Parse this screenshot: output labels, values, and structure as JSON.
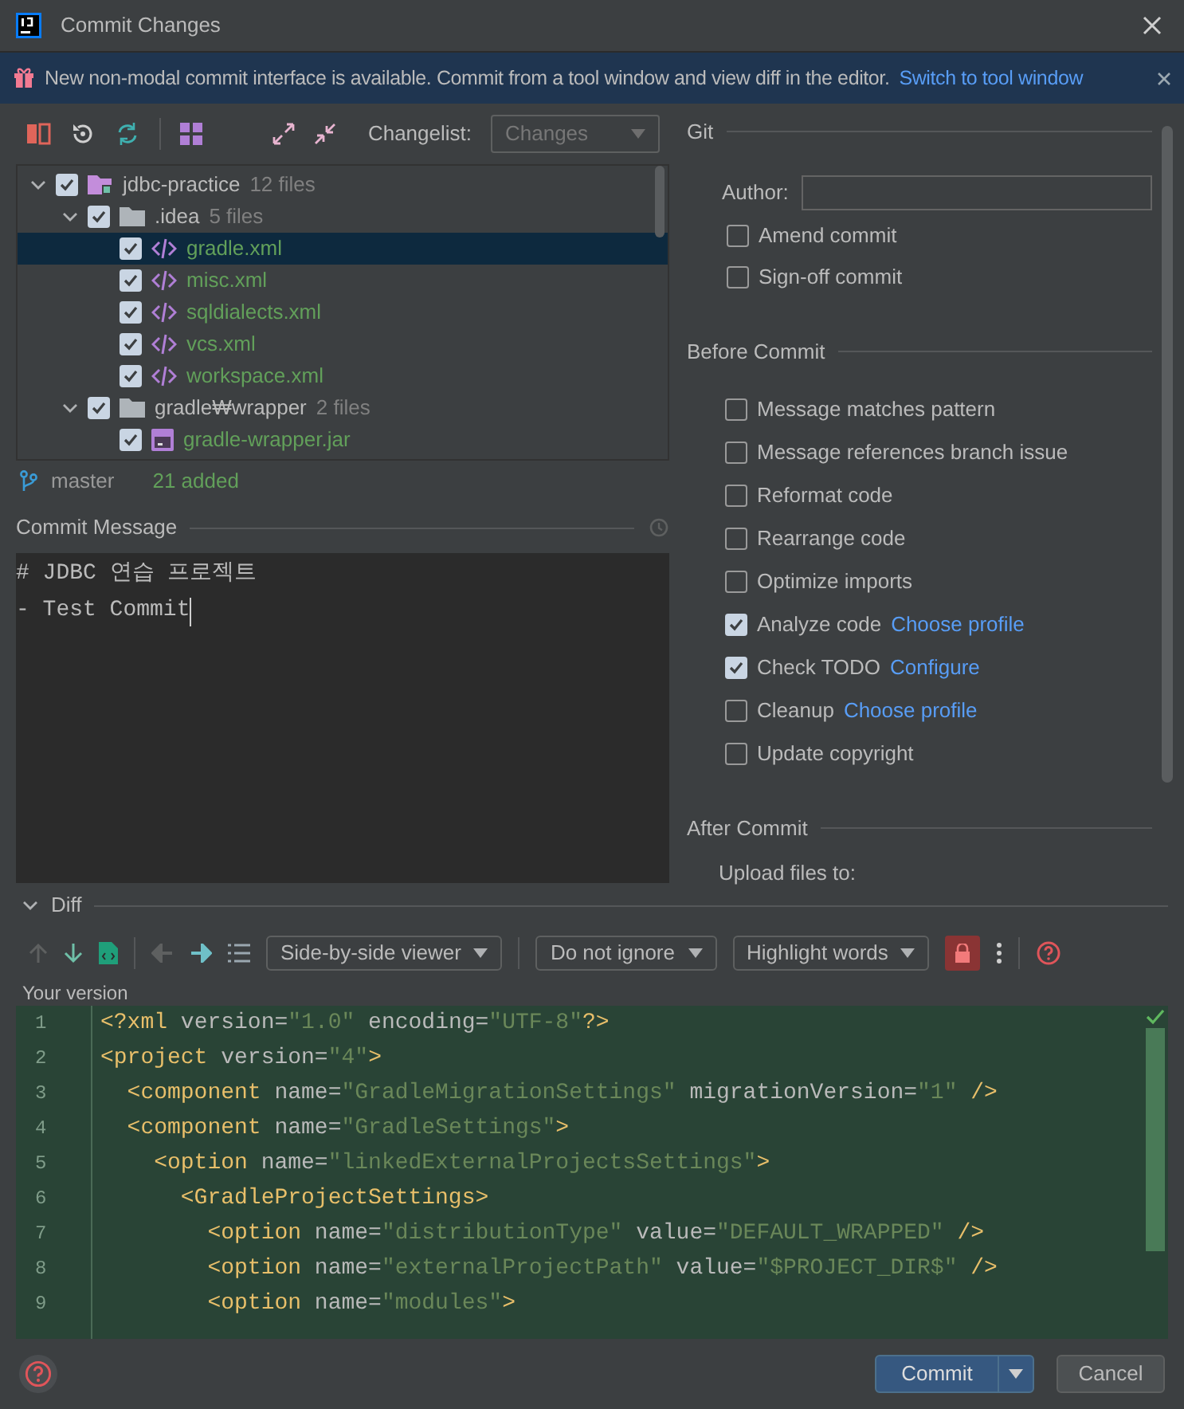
{
  "window": {
    "title": "Commit Changes"
  },
  "banner": {
    "text": "New non-modal commit interface is available. Commit from a tool window and view diff in the editor.",
    "link": "Switch to tool window"
  },
  "changes_toolbar": {
    "changelist_label": "Changelist:",
    "changelist_value": "Changes"
  },
  "tree": [
    {
      "kind": "module",
      "name": "jdbc-practice",
      "count": "12 files",
      "checked": true,
      "expanded": true,
      "selected": false,
      "children": [
        {
          "kind": "folder",
          "name": ".idea",
          "count": "5 files",
          "checked": true,
          "expanded": true,
          "selected": false,
          "children": [
            {
              "kind": "xml",
              "name": "gradle.xml",
              "checked": true,
              "selected": true
            },
            {
              "kind": "xml",
              "name": "misc.xml",
              "checked": true,
              "selected": false
            },
            {
              "kind": "xml",
              "name": "sqldialects.xml",
              "checked": true,
              "selected": false
            },
            {
              "kind": "xml",
              "name": "vcs.xml",
              "checked": true,
              "selected": false
            },
            {
              "kind": "xml",
              "name": "workspace.xml",
              "checked": true,
              "selected": false
            }
          ]
        },
        {
          "kind": "folder",
          "name": "gradle₩wrapper",
          "count": "2 files",
          "checked": true,
          "expanded": true,
          "selected": false,
          "children": [
            {
              "kind": "jar",
              "name": "gradle-wrapper.jar",
              "checked": true,
              "selected": false
            }
          ]
        }
      ]
    }
  ],
  "status": {
    "branch": "master",
    "summary": "21 added"
  },
  "commit_message": {
    "title": "Commit Message",
    "lines": [
      "# JDBC 연습 프로젝트",
      "- Test Commit"
    ]
  },
  "git": {
    "title": "Git",
    "author_label": "Author:",
    "options": [
      {
        "label": "Amend commit",
        "checked": false
      },
      {
        "label": "Sign-off commit",
        "checked": false
      }
    ]
  },
  "before_commit": {
    "title": "Before Commit",
    "options": [
      {
        "label": "Message matches pattern",
        "checked": false
      },
      {
        "label": "Message references branch issue",
        "checked": false
      },
      {
        "label": "Reformat code",
        "checked": false
      },
      {
        "label": "Rearrange code",
        "checked": false
      },
      {
        "label": "Optimize imports",
        "checked": false
      },
      {
        "label": "Analyze code",
        "link": "Choose profile",
        "checked": true
      },
      {
        "label": "Check TODO",
        "link": "Configure",
        "checked": true
      },
      {
        "label": "Cleanup",
        "link": "Choose profile",
        "checked": false
      },
      {
        "label": "Update copyright",
        "checked": false
      }
    ]
  },
  "after_commit": {
    "title": "After Commit",
    "upload_label": "Upload files to:"
  },
  "diff": {
    "title": "Diff",
    "expanded": true,
    "viewer": "Side-by-side viewer",
    "ignore": "Do not ignore",
    "highlight": "Highlight words",
    "version_label": "Your version",
    "lines": [
      {
        "number": "1",
        "tokens": [
          {
            "kind": "tag",
            "text": "<?xml"
          },
          {
            "kind": "attr",
            "text": " version="
          },
          {
            "kind": "value",
            "text": "\"1.0\""
          },
          {
            "kind": "attr",
            "text": " encoding="
          },
          {
            "kind": "value",
            "text": "\"UTF-8\""
          },
          {
            "kind": "tag",
            "text": "?>"
          }
        ]
      },
      {
        "number": "2",
        "tokens": [
          {
            "kind": "tag",
            "text": "<project"
          },
          {
            "kind": "attr",
            "text": " version="
          },
          {
            "kind": "value",
            "text": "\"4\""
          },
          {
            "kind": "tag",
            "text": ">"
          }
        ]
      },
      {
        "number": "3",
        "tokens": [
          {
            "kind": "tag",
            "text": "  <component"
          },
          {
            "kind": "attr",
            "text": " name="
          },
          {
            "kind": "value",
            "text": "\"GradleMigrationSettings\""
          },
          {
            "kind": "attr",
            "text": " migrationVersion="
          },
          {
            "kind": "value",
            "text": "\"1\""
          },
          {
            "kind": "tag",
            "text": " />"
          }
        ]
      },
      {
        "number": "4",
        "tokens": [
          {
            "kind": "tag",
            "text": "  <component"
          },
          {
            "kind": "attr",
            "text": " name="
          },
          {
            "kind": "value",
            "text": "\"GradleSettings\""
          },
          {
            "kind": "tag",
            "text": ">"
          }
        ]
      },
      {
        "number": "5",
        "tokens": [
          {
            "kind": "tag",
            "text": "    <option"
          },
          {
            "kind": "attr",
            "text": " name="
          },
          {
            "kind": "value",
            "text": "\"linkedExternalProjectsSettings\""
          },
          {
            "kind": "tag",
            "text": ">"
          }
        ]
      },
      {
        "number": "6",
        "tokens": [
          {
            "kind": "tag",
            "text": "      <GradleProjectSettings>"
          }
        ]
      },
      {
        "number": "7",
        "tokens": [
          {
            "kind": "tag",
            "text": "        <option"
          },
          {
            "kind": "attr",
            "text": " name="
          },
          {
            "kind": "value",
            "text": "\"distributionType\""
          },
          {
            "kind": "attr",
            "text": " value="
          },
          {
            "kind": "value",
            "text": "\"DEFAULT_WRAPPED\""
          },
          {
            "kind": "tag",
            "text": " />"
          }
        ]
      },
      {
        "number": "8",
        "tokens": [
          {
            "kind": "tag",
            "text": "        <option"
          },
          {
            "kind": "attr",
            "text": " name="
          },
          {
            "kind": "value",
            "text": "\"externalProjectPath\""
          },
          {
            "kind": "attr",
            "text": " value="
          },
          {
            "kind": "value",
            "text": "\"$PROJECT_DIR$\""
          },
          {
            "kind": "tag",
            "text": " />"
          }
        ]
      },
      {
        "number": "9",
        "tokens": [
          {
            "kind": "tag",
            "text": "        <option"
          },
          {
            "kind": "attr",
            "text": " name="
          },
          {
            "kind": "value",
            "text": "\"modules\""
          },
          {
            "kind": "tag",
            "text": ">"
          }
        ]
      }
    ]
  },
  "buttons": {
    "commit": "Commit",
    "cancel": "Cancel"
  }
}
